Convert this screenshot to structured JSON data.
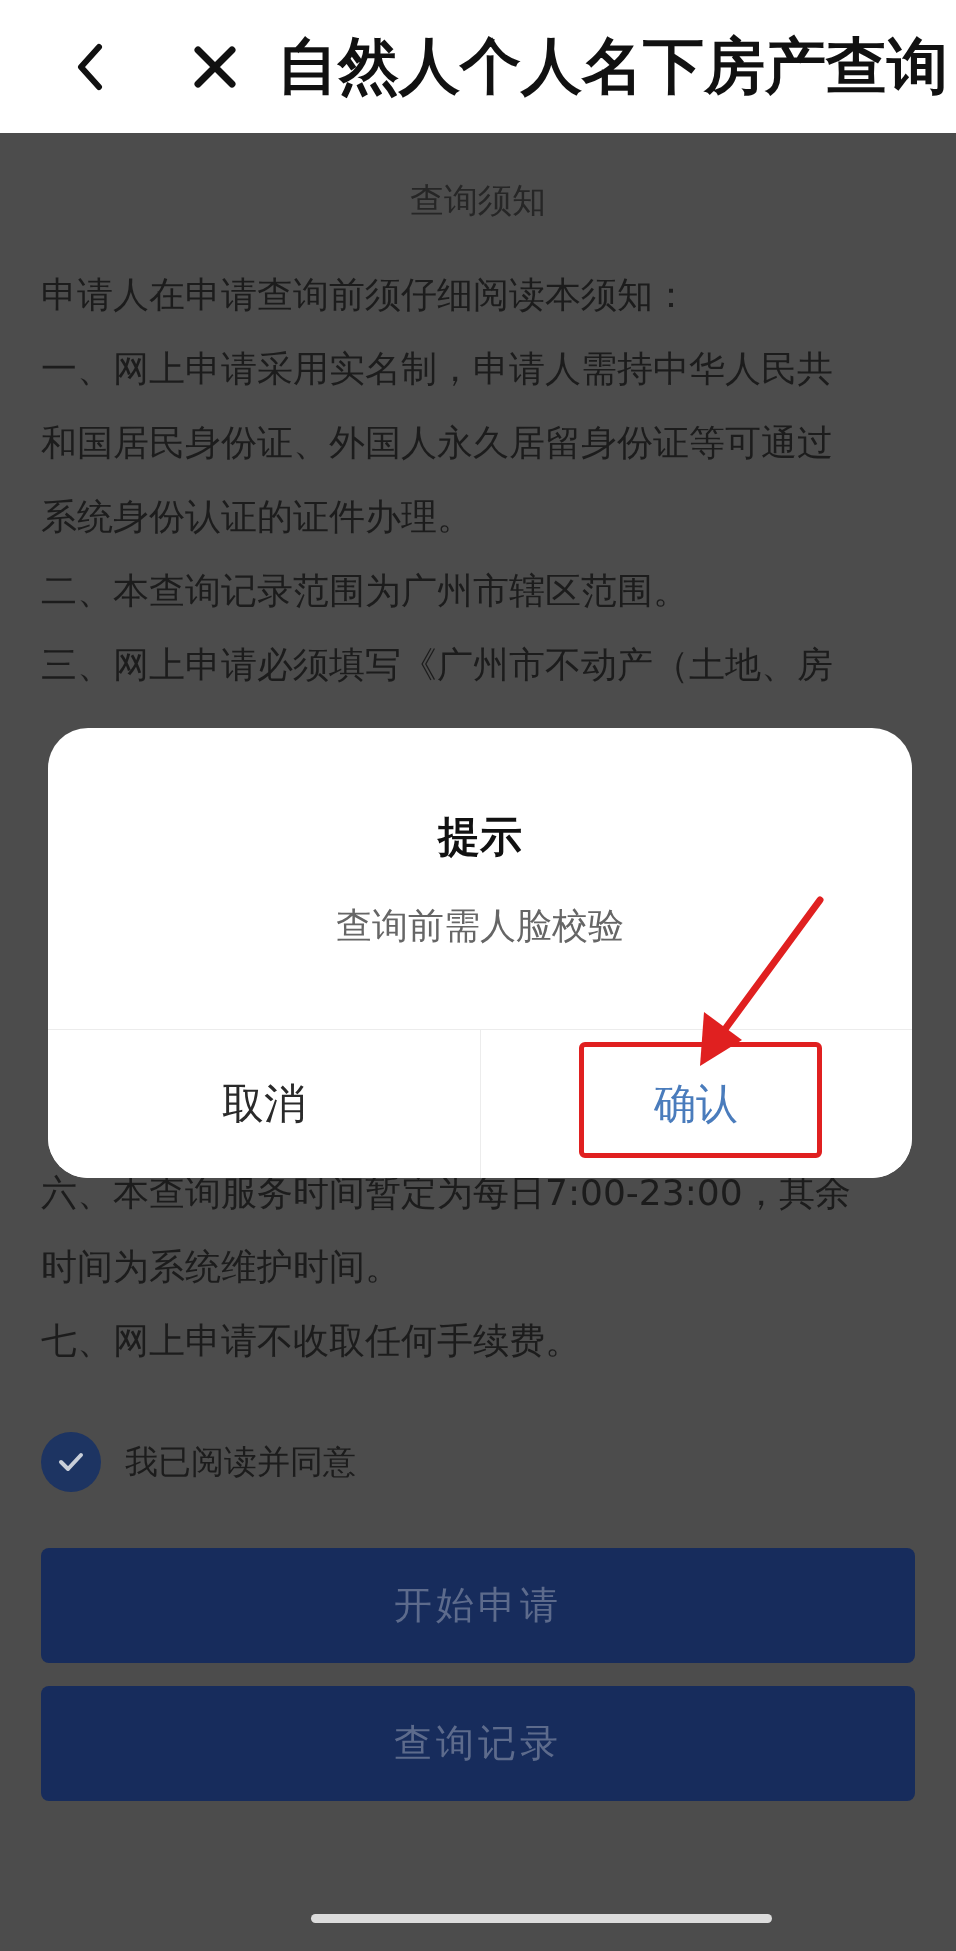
{
  "header": {
    "title": "自然人个人名下房产查询"
  },
  "notice": {
    "title": "查询须知",
    "before_dialog": [
      {
        "lines": [
          "申请人在申请查询前须仔细阅读本须知："
        ]
      },
      {
        "lines": [
          "一、网上申请采用实名制，申请人需持中华人民共",
          "和国居民身份证、外国人永久居留身份证等可通过",
          "系统身份认证的证件办理。"
        ]
      },
      {
        "lines": [
          "二、本查询记录范围为广州市辖区范围。"
        ]
      },
      {
        "lines": [
          "三、网上申请必须填写《广州市不动产（土地、房"
        ]
      }
    ],
    "after_dialog": [
      {
        "lines": [
          "六、本查询服务时间暂定为每日7:00-23:00，其余",
          "时间为系统维护时间。"
        ]
      },
      {
        "lines": [
          "七、网上申请不收取任何手续费。"
        ]
      }
    ]
  },
  "agreement": {
    "label": "我已阅读并同意",
    "checked": true
  },
  "buttons": [
    "开始申请",
    "查询记录"
  ],
  "dialog": {
    "title": "提示",
    "message": "查询前需人脸校验",
    "buttons": [
      {
        "label": "取消",
        "kind": "cancel"
      },
      {
        "label": "确认",
        "kind": "confirm"
      }
    ]
  }
}
